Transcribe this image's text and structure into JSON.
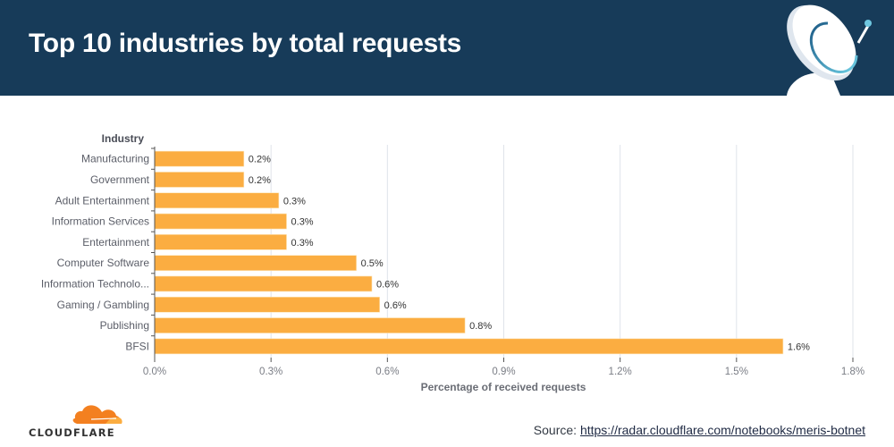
{
  "header": {
    "title": "Top 10 industries by total requests",
    "icon": "satellite-dish-icon"
  },
  "colors": {
    "header_bg": "#173b59",
    "bar": "#fbad41",
    "grid": "#dfe3ea",
    "logo_orange": "#f38020"
  },
  "chart_data": {
    "type": "bar",
    "orientation": "horizontal",
    "title": "Top 10 industries by total requests",
    "ylabel": "Industry",
    "xlabel": "Percentage of received requests",
    "categories": [
      "Manufacturing",
      "Government",
      "Adult Entertainment",
      "Information Services",
      "Entertainment",
      "Computer Software",
      "Information Technolo...",
      "Gaming / Gambling",
      "Publishing",
      "BFSI"
    ],
    "values": [
      0.23,
      0.23,
      0.32,
      0.34,
      0.34,
      0.52,
      0.56,
      0.58,
      0.8,
      1.62
    ],
    "value_labels": [
      "0.2%",
      "0.2%",
      "0.3%",
      "0.3%",
      "0.3%",
      "0.5%",
      "0.6%",
      "0.6%",
      "0.8%",
      "1.6%"
    ],
    "xlim": [
      0,
      1.8
    ],
    "xticks": [
      0,
      0.3,
      0.6,
      0.9,
      1.2,
      1.5,
      1.8
    ],
    "xtick_labels": [
      "0.0%",
      "0.3%",
      "0.6%",
      "0.9%",
      "1.2%",
      "1.5%",
      "1.8%"
    ],
    "grid": true,
    "legend": "none"
  },
  "footer": {
    "logo_text": "CLOUDFLARE",
    "source_prefix": "Source: ",
    "source_link": "https://radar.cloudflare.com/notebooks/meris-botnet"
  }
}
